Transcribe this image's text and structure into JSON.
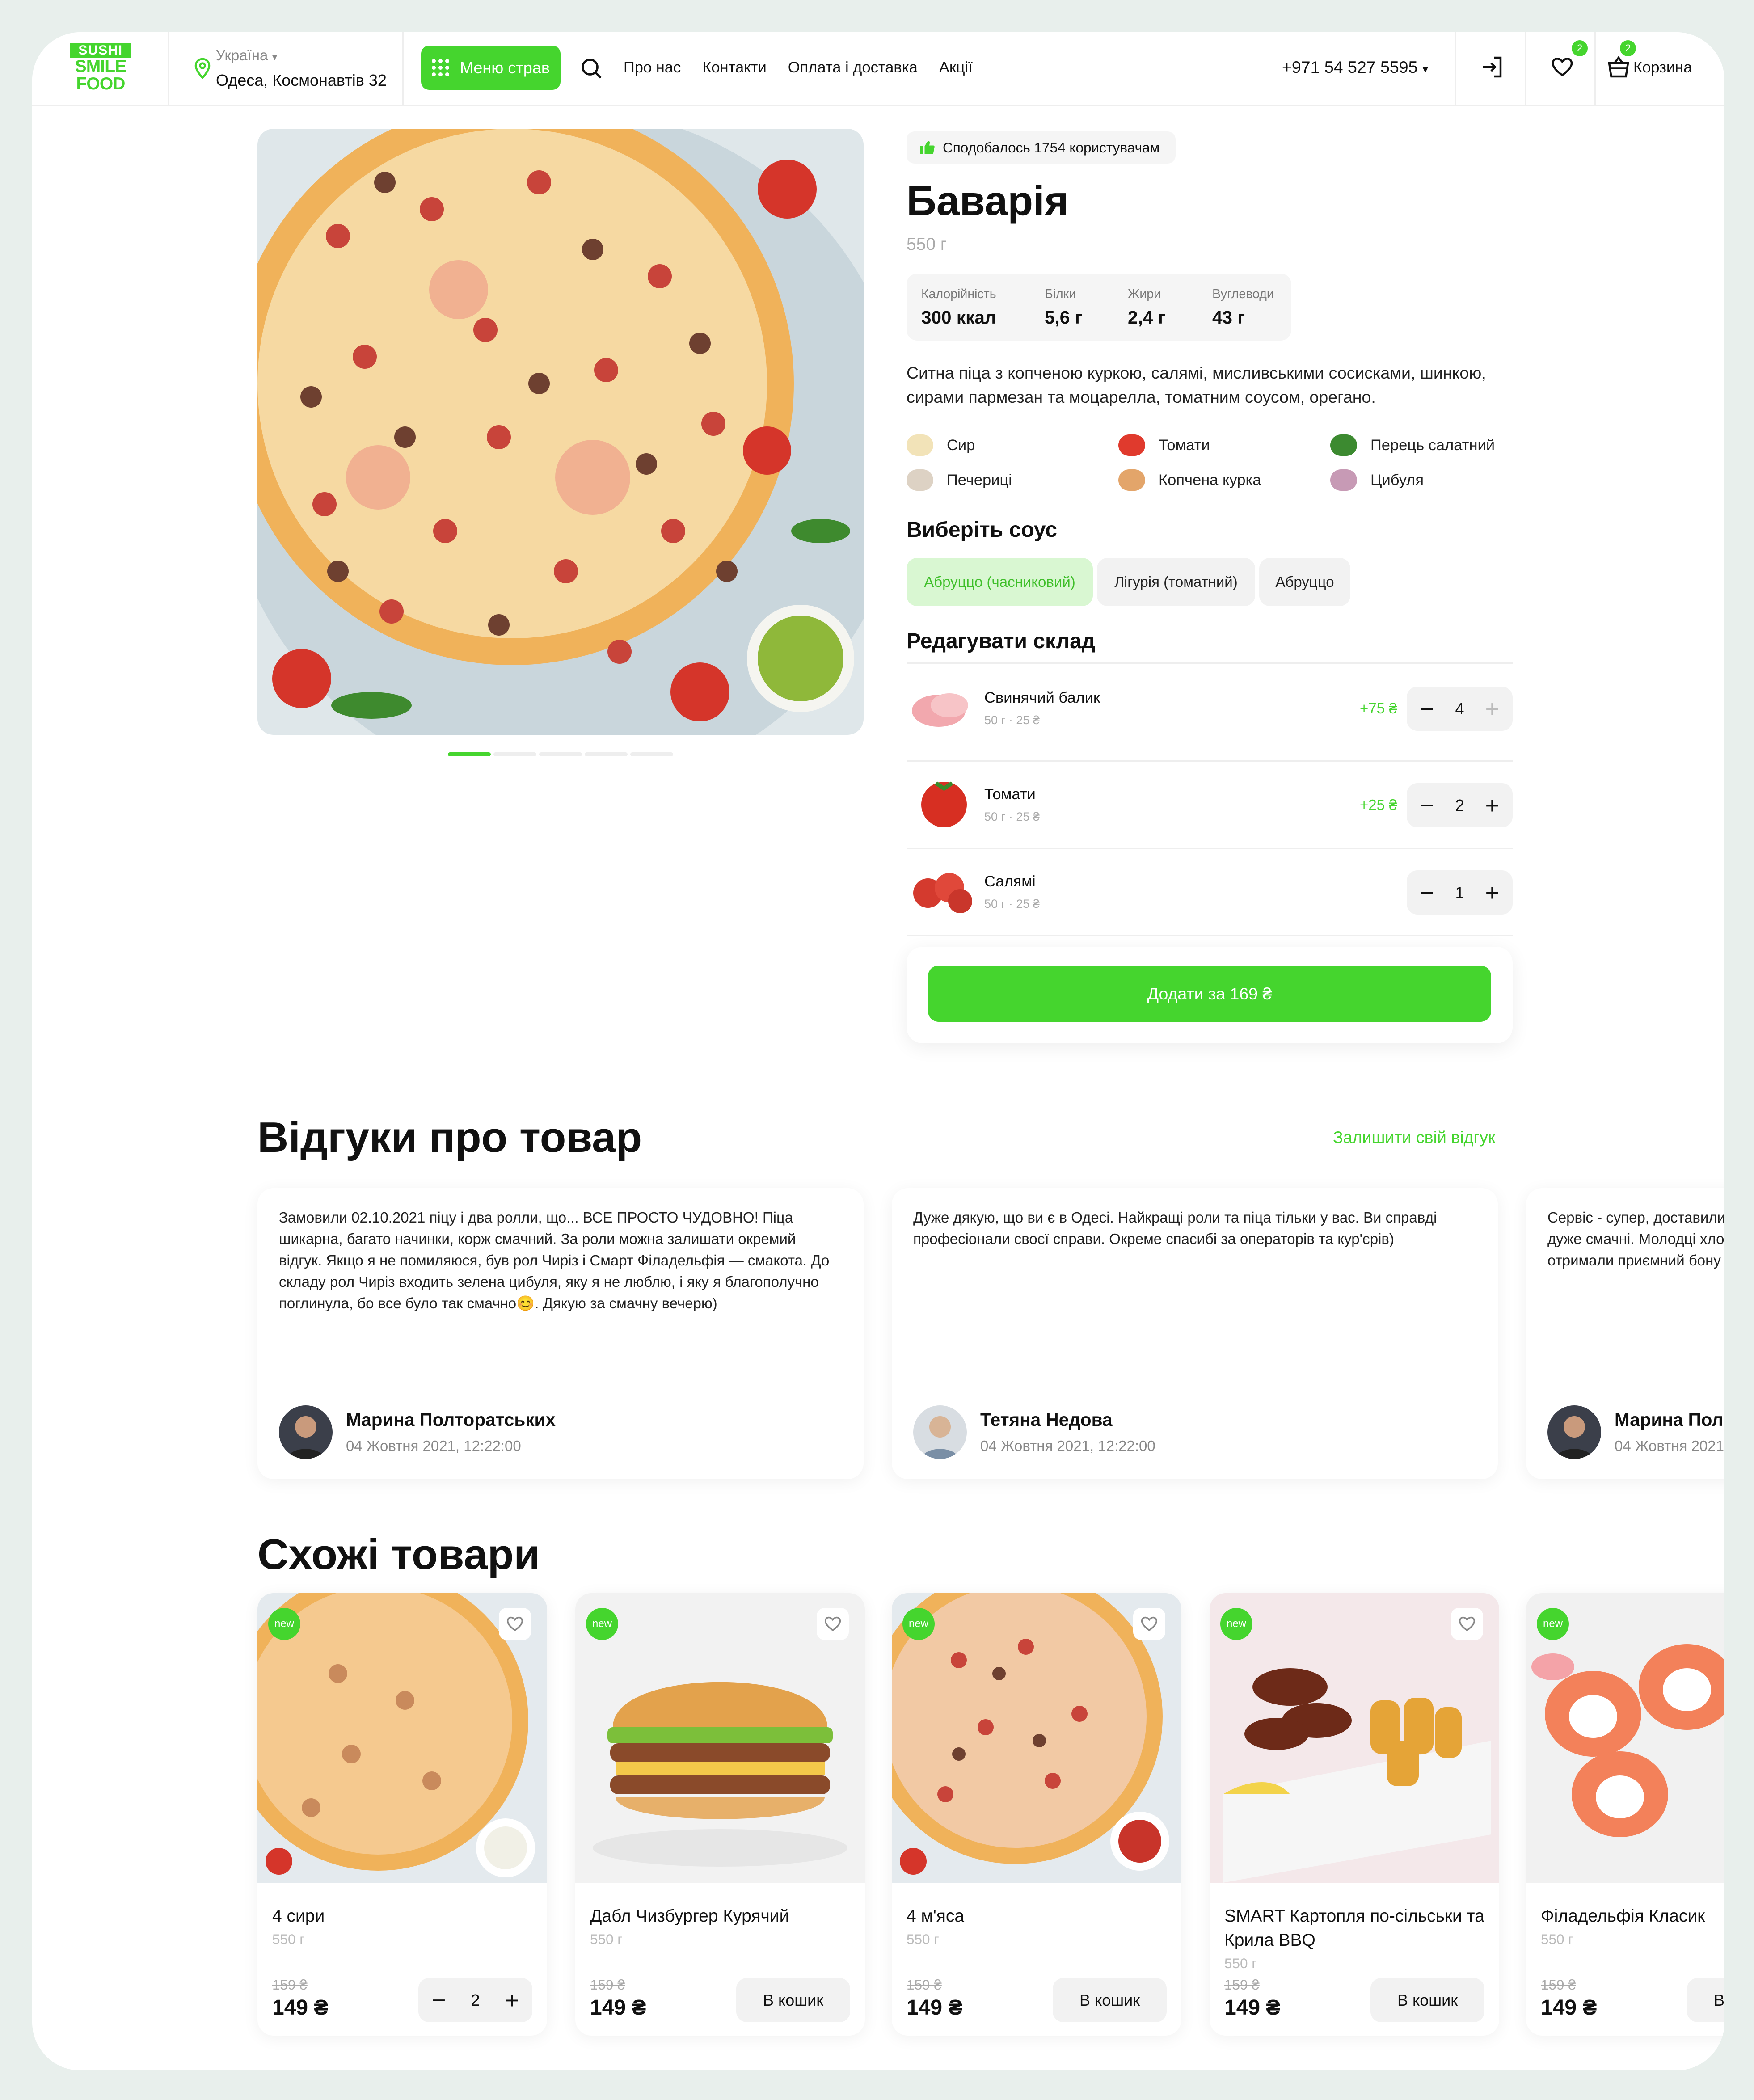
{
  "header": {
    "logo": {
      "line1": "SUSHI",
      "line2": "SMILE",
      "line3": "FOOD"
    },
    "country": "Україна",
    "address": "Одеса, Космонавтів 32",
    "menu_button": "Меню страв",
    "nav": [
      "Про нас",
      "Контакти",
      "Оплата і доставка",
      "Акції"
    ],
    "phone": "+971 54 527 5595",
    "favorites_count": "2",
    "cart_count": "2",
    "cart_label": "Корзина"
  },
  "product": {
    "likes": "Сподобалось 1754 користувачам",
    "title": "Баварія",
    "weight": "550 г",
    "nutrition": [
      {
        "label": "Калорійність",
        "value": "300 ккал"
      },
      {
        "label": "Білки",
        "value": "5,6 г"
      },
      {
        "label": "Жири",
        "value": "2,4 г"
      },
      {
        "label": "Вуглеводи",
        "value": "43 г"
      }
    ],
    "description": "Ситна піца з копченою куркою, салямі, мисливськими сосисками, шинкою, сирами пармезан та моцарелла, томатним соусом, орегано.",
    "ingredients": [
      "Сир",
      "Томати",
      "Перець салатний",
      "Печериці",
      "Копчена курка",
      "Цибуля"
    ],
    "sauce_title": "Виберіть соус",
    "sauces": [
      "Абруццо (часниковий)",
      "Лігурія (томатний)",
      "Абруццо"
    ],
    "selected_sauce_index": 0,
    "edit_title": "Редагувати склад",
    "additions": [
      {
        "name": "Свинячий балик",
        "sub": "50 г · 25 ₴",
        "price": "+75 ₴",
        "qty": "4"
      },
      {
        "name": "Томати",
        "sub": "50 г · 25 ₴",
        "price": "+25 ₴",
        "qty": "2"
      },
      {
        "name": "Салямі",
        "sub": "50 г · 25 ₴",
        "price": "",
        "qty": "1"
      }
    ],
    "add_button": "Додати за 169 ₴",
    "gallery_active_index": 0,
    "gallery_count": 5
  },
  "reviews": {
    "title": "Відгуки про товар",
    "leave_link": "Залишити свій відгук",
    "items": [
      {
        "text": "Замовили 02.10.2021 піцу і два ролли, що... ВСЕ ПРОСТО ЧУДОВНО! Піца шикарна, багато начинки, корж смачний. За роли можна залишати окремий відгук. Якщо я не помиляюся, був рол Чиріз і Смарт Філадельфія — смакота. До складу рол Чиріз входить зелена цибуля, яку я не люблю, і яку я благополучно поглинула, бо все було так смачно😊. Дякую за смачну вечерю)",
        "name": "Марина Полторатських",
        "date": "04 Жовтня 2021, 12:22:00"
      },
      {
        "text": "Дуже дякую, що ви є в Одесі. Найкращі роли та піца тільки у вас. Ви справді професіонали своєї справи. Окреме спасибі за операторів та кур'єрів)",
        "name": "Тетяна Недова",
        "date": "04 Жовтня 2021, 12:22:00"
      },
      {
        "text": "Сервіс - супер, доставили дуже смачні. Молодці хло отримали приємний бону",
        "name": "Марина Полт",
        "date": "04 Жовтня 2021"
      }
    ]
  },
  "similar": {
    "title": "Схожі товари",
    "new_badge": "new",
    "cart_button": "В кошик",
    "items": [
      {
        "name": "4 сири",
        "weight": "550 г",
        "old_price": "159 ₴",
        "price": "149 ₴",
        "qty": "2"
      },
      {
        "name": "Дабл Чизбургер Курячий",
        "weight": "550 г",
        "old_price": "159 ₴",
        "price": "149 ₴"
      },
      {
        "name": "4 м'яса",
        "weight": "550 г",
        "old_price": "159 ₴",
        "price": "149 ₴"
      },
      {
        "name": "SMART Картопля по-сільськи та Крила BBQ",
        "weight": "550 г",
        "old_price": "159 ₴",
        "price": "149 ₴"
      },
      {
        "name": "Філадельфія Класик",
        "weight": "550 г",
        "old_price": "159 ₴",
        "price": "149 ₴"
      }
    ]
  },
  "colors": {
    "accent": "#45d52e",
    "accent_light": "#d9f7d2",
    "background": "#e8efec"
  }
}
